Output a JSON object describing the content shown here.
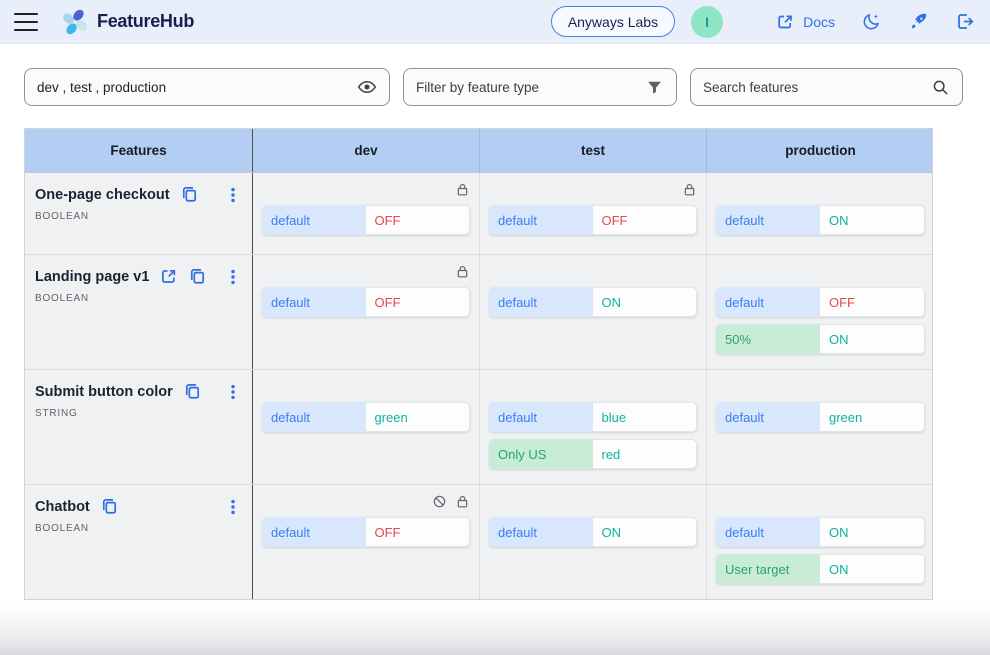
{
  "colors": {
    "accent_blue": "#2f6fe4",
    "header_bg": "#e9eefb",
    "table_header_bg": "#b3cdf3",
    "default_chip_bg": "#d9e7fd",
    "default_chip_text": "#3b7df2",
    "strategy_chip_bg": "#c9ecd9",
    "strategy_chip_text": "#27a568",
    "value_on": "#0db3a0",
    "value_off": "#e8474f",
    "avatar_bg": "#8fe6c6",
    "avatar_text": "#0f9d8f"
  },
  "header": {
    "brand": "FeatureHub",
    "portfolio_button": "Anyways Labs",
    "avatar_letter": "I",
    "docs_label": "Docs"
  },
  "filters": {
    "environments_value": "dev , test , production",
    "feature_type_placeholder": "Filter by feature type",
    "search_placeholder": "Search features"
  },
  "table": {
    "columns": [
      "Features",
      "dev",
      "test",
      "production"
    ],
    "rows": [
      {
        "name": "One-page checkout",
        "type": "BOOLEAN",
        "external_link": false,
        "envs": [
          {
            "locked": true,
            "not_changeable": false,
            "strategies": [
              {
                "label": "default",
                "kind": "default",
                "value": "OFF",
                "state": "off"
              }
            ]
          },
          {
            "locked": true,
            "not_changeable": false,
            "strategies": [
              {
                "label": "default",
                "kind": "default",
                "value": "OFF",
                "state": "off"
              }
            ]
          },
          {
            "locked": false,
            "not_changeable": false,
            "strategies": [
              {
                "label": "default",
                "kind": "default",
                "value": "ON",
                "state": "on"
              }
            ]
          }
        ]
      },
      {
        "name": "Landing page v1",
        "type": "BOOLEAN",
        "external_link": true,
        "envs": [
          {
            "locked": true,
            "not_changeable": false,
            "strategies": [
              {
                "label": "default",
                "kind": "default",
                "value": "OFF",
                "state": "off"
              }
            ]
          },
          {
            "locked": false,
            "not_changeable": false,
            "strategies": [
              {
                "label": "default",
                "kind": "default",
                "value": "ON",
                "state": "on"
              }
            ]
          },
          {
            "locked": false,
            "not_changeable": false,
            "strategies": [
              {
                "label": "default",
                "kind": "default",
                "value": "OFF",
                "state": "off"
              },
              {
                "label": "50%",
                "kind": "custom",
                "value": "ON",
                "state": "on"
              }
            ]
          }
        ]
      },
      {
        "name": "Submit button color",
        "type": "STRING",
        "external_link": false,
        "envs": [
          {
            "locked": false,
            "not_changeable": false,
            "strategies": [
              {
                "label": "default",
                "kind": "default",
                "value": "green",
                "state": "on"
              }
            ]
          },
          {
            "locked": false,
            "not_changeable": false,
            "strategies": [
              {
                "label": "default",
                "kind": "default",
                "value": "blue",
                "state": "on"
              },
              {
                "label": "Only US",
                "kind": "custom",
                "value": "red",
                "state": "on"
              }
            ]
          },
          {
            "locked": false,
            "not_changeable": false,
            "strategies": [
              {
                "label": "default",
                "kind": "default",
                "value": "green",
                "state": "on"
              }
            ]
          }
        ]
      },
      {
        "name": "Chatbot",
        "type": "BOOLEAN",
        "external_link": false,
        "envs": [
          {
            "locked": true,
            "not_changeable": true,
            "strategies": [
              {
                "label": "default",
                "kind": "default",
                "value": "OFF",
                "state": "off"
              }
            ]
          },
          {
            "locked": false,
            "not_changeable": false,
            "strategies": [
              {
                "label": "default",
                "kind": "default",
                "value": "ON",
                "state": "on"
              }
            ]
          },
          {
            "locked": false,
            "not_changeable": false,
            "strategies": [
              {
                "label": "default",
                "kind": "default",
                "value": "ON",
                "state": "on"
              },
              {
                "label": "User target",
                "kind": "custom",
                "value": "ON",
                "state": "on"
              }
            ]
          }
        ]
      }
    ]
  }
}
